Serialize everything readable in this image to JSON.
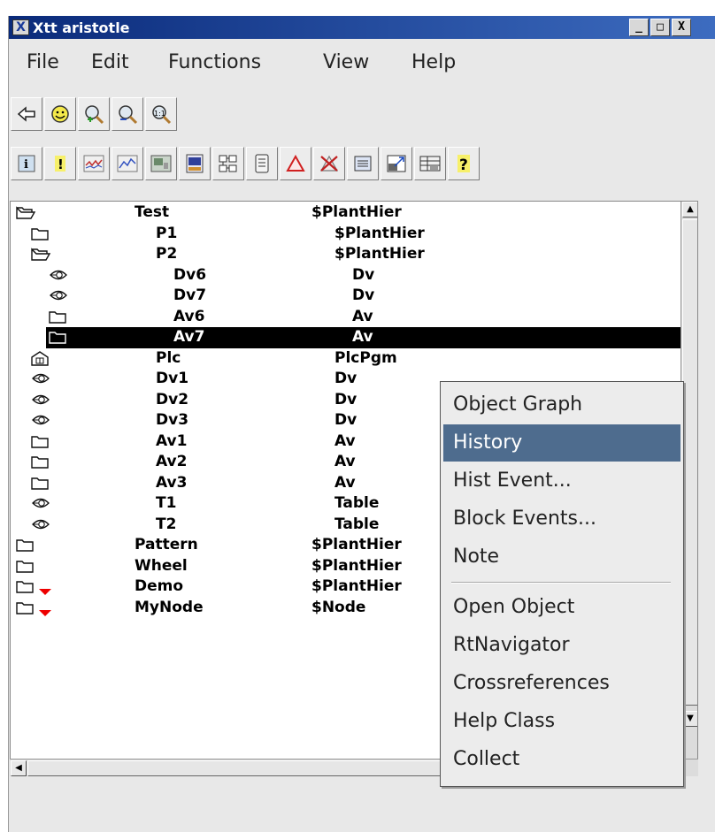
{
  "window": {
    "title": "Xtt aristotle",
    "app_icon_glyph": "X",
    "buttons": {
      "minimize": "_",
      "maximize": "□",
      "close": "X"
    }
  },
  "menubar": [
    "File",
    "Edit",
    "Functions",
    "View",
    "Help"
  ],
  "toolbar1": [
    "back-arrow-icon",
    "smiley-icon",
    "zoom-in-icon",
    "zoom-out-icon",
    "zoom-reset-icon"
  ],
  "toolbar2": [
    "info-icon",
    "alarm-icon",
    "trend-icon",
    "curve-icon",
    "image-icon",
    "graph-icon",
    "crossref-icon",
    "document-icon",
    "warning-triangle-icon",
    "no-alarm-icon",
    "list-icon",
    "resize-icon",
    "table-icon",
    "help-icon"
  ],
  "tree": {
    "rows": [
      {
        "icon": "folder-open-icon",
        "name": "Test",
        "cls": "$PlantHier",
        "level": 0
      },
      {
        "icon": "folder-icon",
        "name": "P1",
        "cls": "$PlantHier",
        "level": 1
      },
      {
        "icon": "folder-open-icon",
        "name": "P2",
        "cls": "$PlantHier",
        "level": 1
      },
      {
        "icon": "leaf-icon",
        "name": "Dv6",
        "cls": "Dv",
        "level": 2
      },
      {
        "icon": "leaf-icon",
        "name": "Dv7",
        "cls": "Dv",
        "level": 2
      },
      {
        "icon": "folder-icon",
        "name": "Av6",
        "cls": "Av",
        "level": 2
      },
      {
        "icon": "folder-icon",
        "name": "Av7",
        "cls": "Av",
        "level": 2,
        "selected": true
      },
      {
        "icon": "plc-icon",
        "name": "Plc",
        "cls": "PlcPgm",
        "level": 1
      },
      {
        "icon": "leaf-icon",
        "name": "Dv1",
        "cls": "Dv",
        "level": 1
      },
      {
        "icon": "leaf-icon",
        "name": "Dv2",
        "cls": "Dv",
        "level": 1
      },
      {
        "icon": "leaf-icon",
        "name": "Dv3",
        "cls": "Dv",
        "level": 1
      },
      {
        "icon": "folder-icon",
        "name": "Av1",
        "cls": "Av",
        "level": 1
      },
      {
        "icon": "folder-icon",
        "name": "Av2",
        "cls": "Av",
        "level": 1
      },
      {
        "icon": "folder-icon",
        "name": "Av3",
        "cls": "Av",
        "level": 1
      },
      {
        "icon": "leaf-icon",
        "name": "T1",
        "cls": "Table",
        "level": 1
      },
      {
        "icon": "leaf-icon",
        "name": "T2",
        "cls": "Table",
        "level": 1
      },
      {
        "icon": "folder-icon",
        "name": "Pattern",
        "cls": "$PlantHier",
        "level": 0
      },
      {
        "icon": "folder-icon",
        "name": "Wheel",
        "cls": "$PlantHier",
        "level": 0
      },
      {
        "icon": "folder-icon",
        "name": "Demo",
        "cls": "$PlantHier",
        "level": 0,
        "marker": "red-triangle-icon"
      },
      {
        "icon": "folder-icon",
        "name": "MyNode",
        "cls": "$Node",
        "level": 0,
        "marker": "red-triangle-icon"
      }
    ]
  },
  "context_menu": {
    "items": [
      "Object Graph",
      "History",
      "Hist Event...",
      "Block Events...",
      "Note",
      "Open Object",
      "RtNavigator",
      "Crossreferences",
      "Help Class",
      "Collect"
    ],
    "highlighted": "History",
    "separator_after": "Note"
  },
  "colors": {
    "title_bar_start": "#0a2a7a",
    "title_bar_end": "#3d6cc0",
    "menu_highlight": "#4e6c8e",
    "marker_red": "#ee0000"
  }
}
